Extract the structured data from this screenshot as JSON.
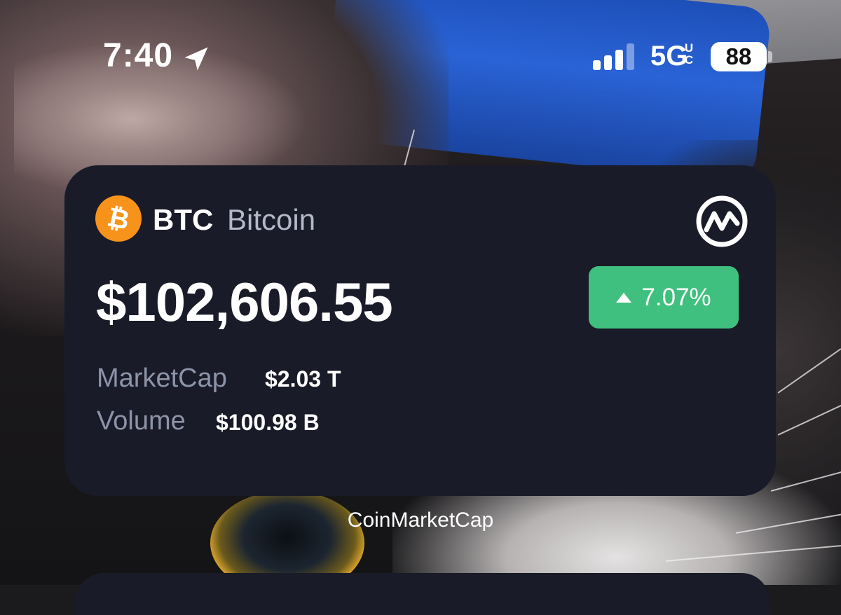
{
  "status_bar": {
    "time": "7:40",
    "network": "5G",
    "network_sup": "U C",
    "battery": "88"
  },
  "widget": {
    "symbol": "BTC",
    "name": "Bitcoin",
    "price": "$102,606.55",
    "change": "7.07%",
    "change_direction": "up",
    "stats": {
      "marketcap_label": "MarketCap",
      "marketcap_value": "$2.03 T",
      "volume_label": "Volume",
      "volume_value": "$100.98 B"
    },
    "coin_logo_glyph": "₿"
  },
  "caption": "CoinMarketCap",
  "icons": {
    "location": "location-arrow-icon",
    "signal": "cellular-signal-icon",
    "coin": "bitcoin-logo-icon",
    "cmc": "coinmarketcap-logo-icon",
    "change": "triangle-up-icon"
  },
  "colors": {
    "widget_bg": "#191b28",
    "positive": "#3fc07e",
    "bitcoin_orange": "#f7931a",
    "muted_text": "#8d93a8"
  }
}
